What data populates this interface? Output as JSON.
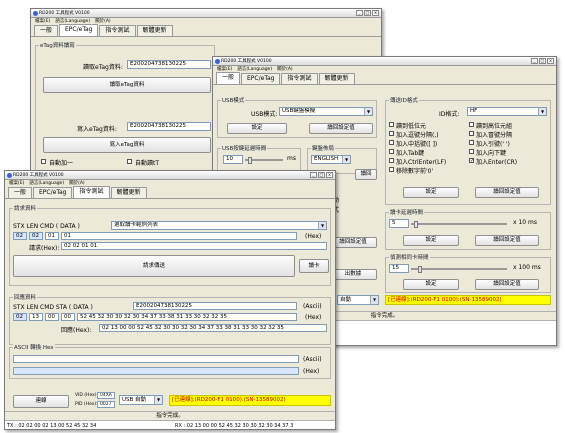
{
  "windows": {
    "back": {
      "title": "RD200 工具程式 V0100",
      "menu": [
        "檔案(E)",
        "語言(Language)",
        "關於(A)"
      ],
      "tabs": [
        "一般",
        "EPC/eTag",
        "指令測試",
        "韌體更新"
      ],
      "group_label": "eTag資料讀寫",
      "read_field_label": "讀取eTag資料:",
      "read_field_value": "E2002047381302​25",
      "read_button": "讀取eTag資料",
      "write_field_label": "寫入eTag資料:",
      "write_field_value": "E2002047381302​25",
      "write_button": "寫入eTag資料",
      "auto_add": "自動加一",
      "auto_read": "自動讀tT"
    },
    "middle": {
      "title": "RD200 工具程式 V0100",
      "menu": [
        "檔案(E)",
        "語言(Language)",
        "關於(A)"
      ],
      "tabs": [
        "一般",
        "EPC/eTag",
        "指令測試",
        "韌體更新"
      ],
      "usb_group": "USB模式",
      "usb_mode_label": "USB模式:",
      "usb_mode_value": "USB鍵盤模擬",
      "set_button": "設定",
      "read_setting_button": "讀回設定值",
      "delay_group": "USB按鍵延遲時間",
      "delay_value": "10",
      "delay_unit": "ms",
      "layout_group": "鍵盤佈局",
      "layout_value": "ENGLISH",
      "read_button_cut": "讀回",
      "side_text_1": "動",
      "side_text_2": "式",
      "side_read_setting": "讀回設定值",
      "side_out_data": "出數據",
      "send_group": "傳送ID格式",
      "id_format_label": "ID格式:",
      "id_format_value": "HF",
      "options_left": [
        "讀到低位元",
        "加入逗號分隔(,)",
        "加入中括號([ ])",
        "加入Tab鍵",
        "加入CtrlEnter(LF)",
        "移除數字前'0'"
      ],
      "options_right": [
        "讀到高位元組",
        "加入冒號分隔",
        "加入引號(' ')",
        "加入向下鍵",
        "加入Enter(CR)"
      ],
      "options_right_checked": [
        false,
        false,
        false,
        false,
        true
      ],
      "send_set": "設定",
      "send_read": "讀回設定值",
      "card_delay_group": "讀卡延遲時間",
      "card_delay_value": "5",
      "card_delay_unit": "x 10 ms",
      "card_set": "設定",
      "card_read": "讀回設定值",
      "repeat_group": "偵測相同卡時間",
      "repeat_value": "15",
      "repeat_unit": "x 100 ms",
      "repeat_set": "設定",
      "repeat_read": "讀回設定值",
      "bottom_auto": "自動",
      "status_connected": "[已連線]:(RD200-F1  0100):(SN-13589002)",
      "status_done": "指令完成。"
    },
    "front": {
      "title": "RD200 工具程式 V0100",
      "menu": [
        "檔案(E)",
        "語言(Language)",
        "關於(A)"
      ],
      "tabs": [
        "一般",
        "EPC/eTag",
        "指令測試",
        "韌體更新"
      ],
      "request_group": "請求資料",
      "request_headers": "STX  LEN  CMD  ( DATA )",
      "request_dropdown": "選取讀卡範例列表",
      "request_stx": "02",
      "request_len": "02",
      "request_cmd": "01",
      "request_data": "01",
      "hex_unit": "(Hex)",
      "request_hex_label": "請求(Hex):",
      "request_hex_value": "02 02 01 01",
      "send_request_button": "請求傳送",
      "read_card_button": "讀卡",
      "response_group": "回應資料",
      "response_headers": "STX  LEN  CMD  STA  ( DATA )",
      "response_data": "E2002047381302​25",
      "ascii_unit": "(Ascii)",
      "response_stx": "02",
      "response_len": "13",
      "response_cmd": "00",
      "response_sta": "00",
      "response_hex_data": "52 45 32 30 30 32 30 34 37 33 38 31 33 30 32 32 35",
      "response_hex_label": "回應(Hex):",
      "response_hex_value": "02 13 00 00 52 45 32 30 30 32 30 34 37 33 38 31 33 30 32 32 35",
      "ascii_group": "ASCII 轉換 Hex",
      "ascii_unit2": "(Ascii)",
      "hex_unit2": "(Hex)",
      "exit_button": "連線",
      "vid_label": "VID (Hex):",
      "vid_value": "04XA",
      "pid_label": "PID (Hex):",
      "pid_value": "0027",
      "usb_auto": "USB 自動",
      "status_connected": "[已連線]:(RD200-F1  0100):(SN-13589002)",
      "status_done": "指令完成。",
      "log_left": "TX : 02 02 00 02 13 00 52 45 32 34",
      "log_right": "RX : 02 13 00 00 52 45 32 30 30 32 30 34 37 3"
    }
  }
}
